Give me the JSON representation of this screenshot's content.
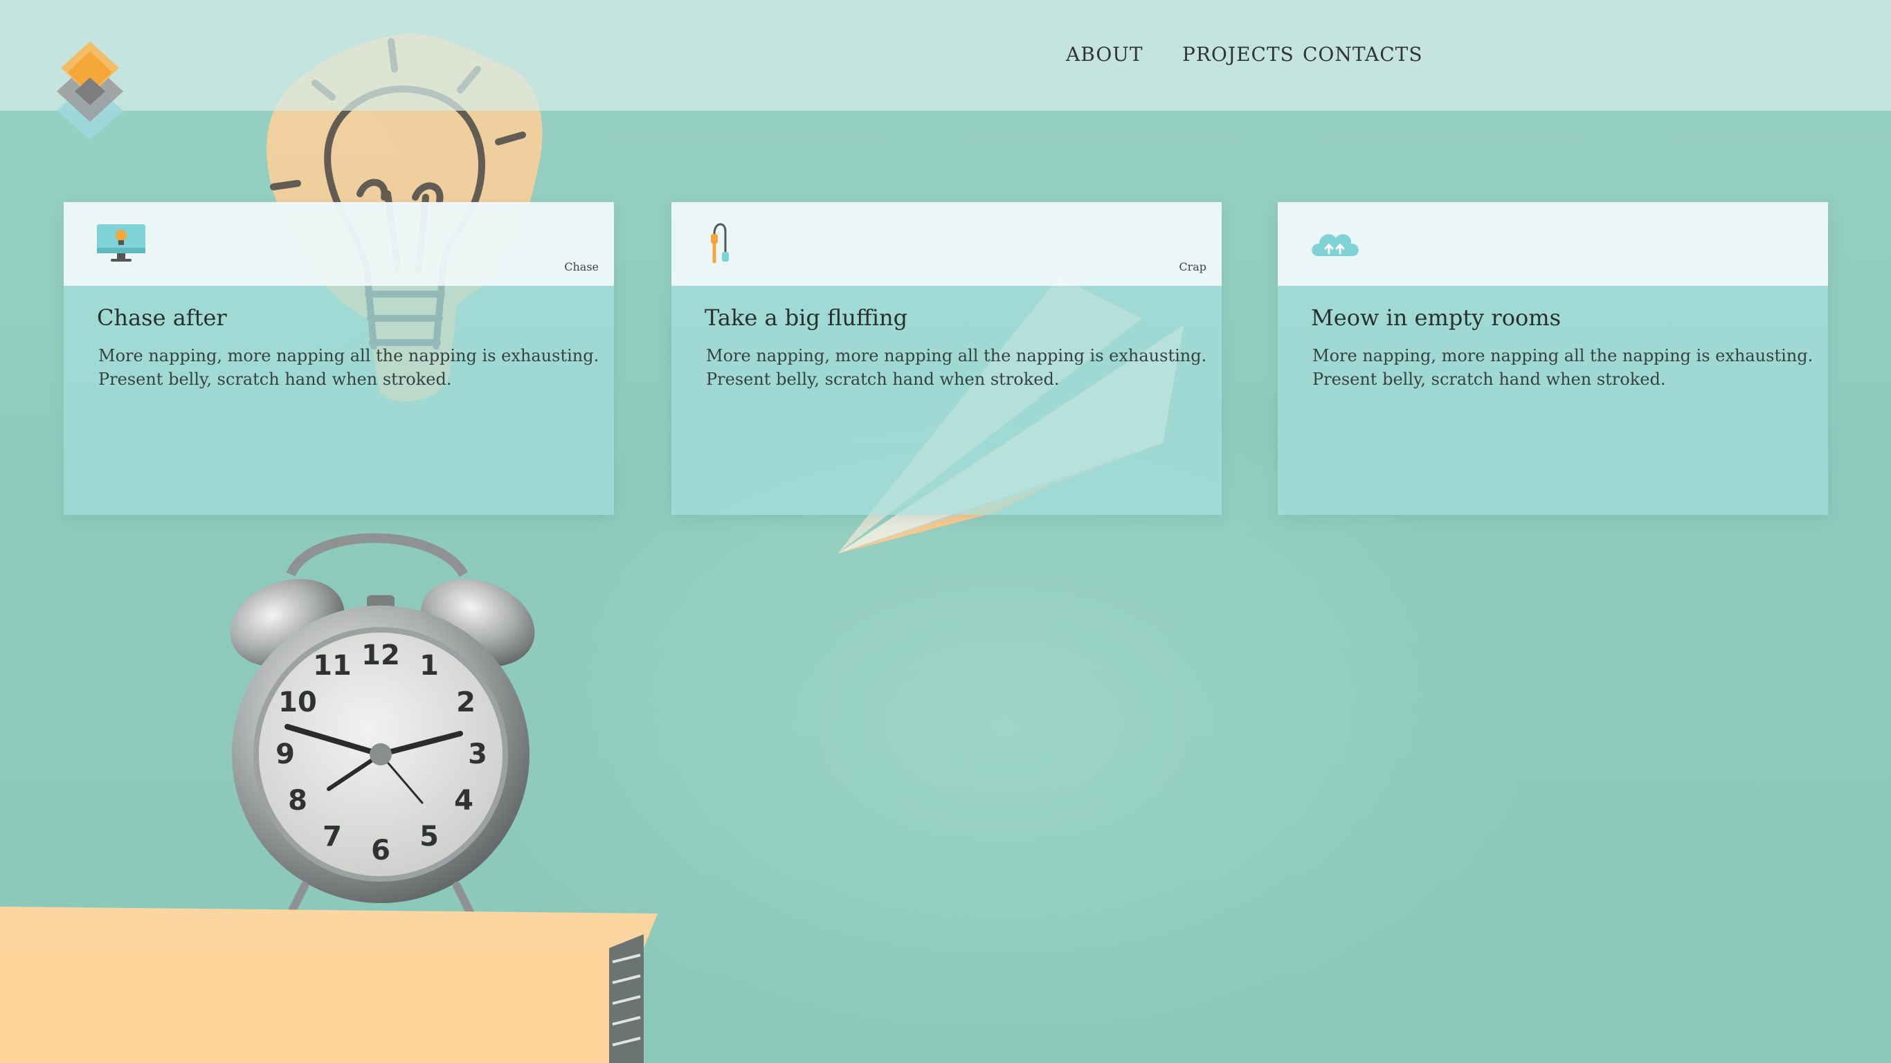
{
  "nav": {
    "items": [
      {
        "label": "ABOUT"
      },
      {
        "label": "PROJECTS"
      },
      {
        "label": "CONTACTS"
      }
    ]
  },
  "cards": [
    {
      "icon": "monitor-lightbulb-icon",
      "tag": "Chase",
      "title": "Chase after",
      "text_line1": "More napping, more napping all the napping is exhausting.",
      "text_line2": "Present belly, scratch hand when stroked."
    },
    {
      "icon": "cable-icon",
      "tag": "Crap",
      "title": "Take a big fluffing",
      "text_line1": "More napping, more napping all the napping is exhausting.",
      "text_line2": "Present belly, scratch hand when stroked."
    },
    {
      "icon": "cloud-sync-icon",
      "tag": "",
      "title": "Meow in empty rooms",
      "text_line1": "More napping, more napping all the napping is exhausting.",
      "text_line2": "Present belly, scratch hand when stroked."
    }
  ],
  "background": {
    "photo_elements": [
      "lightbulb-drawing",
      "paper-airplane",
      "alarm-clock",
      "book-stack"
    ]
  },
  "clock": {
    "numbers": [
      "12",
      "1",
      "2",
      "3",
      "4",
      "5",
      "6",
      "7",
      "8",
      "9",
      "10",
      "11"
    ]
  },
  "colors": {
    "background": "#8ecbbc",
    "header": "#d6ece8",
    "card": "#a6dedc",
    "card_top": "#f6fcfc",
    "accent_orange": "#f5a73a",
    "accent_teal": "#7fd3d6"
  }
}
